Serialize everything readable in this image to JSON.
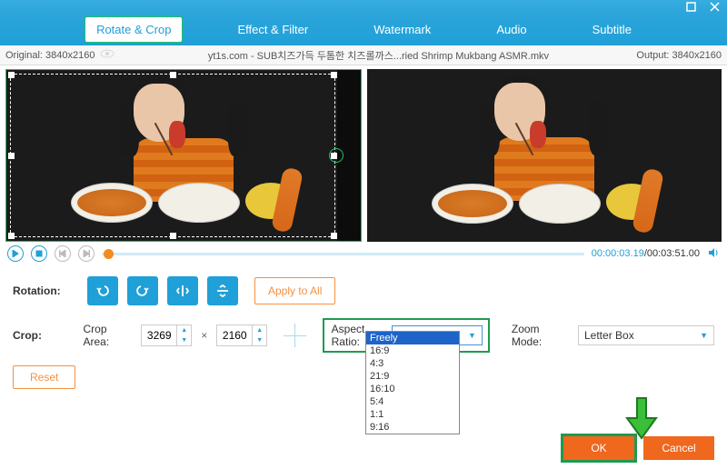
{
  "tabs": {
    "rotate": "Rotate & Crop",
    "effect": "Effect & Filter",
    "watermark": "Watermark",
    "audio": "Audio",
    "subtitle": "Subtitle"
  },
  "filebar": {
    "original_label": "Original:",
    "original_dim": "3840x2160",
    "filename": "yt1s.com - SUB치즈가득 두톰한 치즈롤까스...ried Shrimp Mukbang ASMR.mkv",
    "output_label": "Output:",
    "output_dim": "3840x2160"
  },
  "transport": {
    "current": "00:00:03.19",
    "total": "/00:03:51.00"
  },
  "rotation": {
    "label": "Rotation:",
    "apply_all": "Apply to All"
  },
  "crop": {
    "label": "Crop:",
    "area_label": "Crop Area:",
    "w": "3269",
    "h": "2160",
    "aspect_label": "Aspect Ratio:",
    "aspect_value": "Freely",
    "zoom_label": "Zoom Mode:",
    "zoom_value": "Letter Box",
    "reset": "Reset"
  },
  "aspect_options": [
    "Freely",
    "16:9",
    "4:3",
    "21:9",
    "16:10",
    "5:4",
    "1:1",
    "9:16"
  ],
  "footer": {
    "ok": "OK",
    "cancel": "Cancel"
  }
}
